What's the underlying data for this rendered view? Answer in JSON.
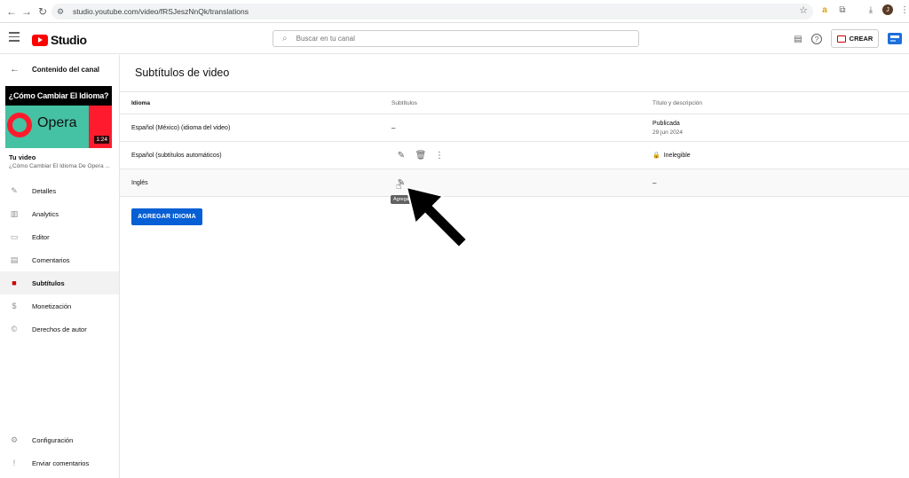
{
  "browser": {
    "url": "studio.youtube.com/video/fRSJeszNnQk/translations",
    "profile_initial": "J"
  },
  "header": {
    "logo_text": "Studio",
    "search_placeholder": "Buscar en tu canal",
    "create_label": "CREAR"
  },
  "sidebar": {
    "back_label": "Contenido del canal",
    "thumbnail": {
      "title_overlay": "¿Cómo Cambiar El Idioma?",
      "brand_text": "Opera",
      "duration": "1:24"
    },
    "your_video_label": "Tu video",
    "video_title": "¿Cómo Cambiar El Idioma De Opera ...",
    "items": [
      {
        "label": "Detalles",
        "icon": "pencil-icon"
      },
      {
        "label": "Analytics",
        "icon": "analytics-icon"
      },
      {
        "label": "Editor",
        "icon": "editor-icon"
      },
      {
        "label": "Comentarios",
        "icon": "comments-icon"
      },
      {
        "label": "Subtítulos",
        "icon": "subtitles-icon"
      },
      {
        "label": "Monetización",
        "icon": "dollar-icon"
      },
      {
        "label": "Derechos de autor",
        "icon": "copyright-icon"
      }
    ],
    "bottom_items": [
      {
        "label": "Configuración",
        "icon": "gear-icon"
      },
      {
        "label": "Enviar comentarios",
        "icon": "feedback-icon"
      }
    ]
  },
  "main": {
    "page_title": "Subtítulos de video",
    "columns": {
      "language": "Idioma",
      "subtitles": "Subtítulos",
      "title_desc": "Título y descripción"
    },
    "rows": [
      {
        "language": "Español (México) (idioma del video)",
        "subtitles": "–",
        "status": "Publicada",
        "date": "29 jun 2024"
      },
      {
        "language": "Español (subtítulos automáticos)",
        "status": "Inelegible"
      },
      {
        "language": "Inglés",
        "title_desc": "–"
      }
    ],
    "tooltip": "Agregar",
    "add_language_button": "AGREGAR IDIOMA"
  },
  "colors": {
    "accent": "#065fd4",
    "brand_red": "#ff0000",
    "active_bg": "#f2f2f2"
  }
}
